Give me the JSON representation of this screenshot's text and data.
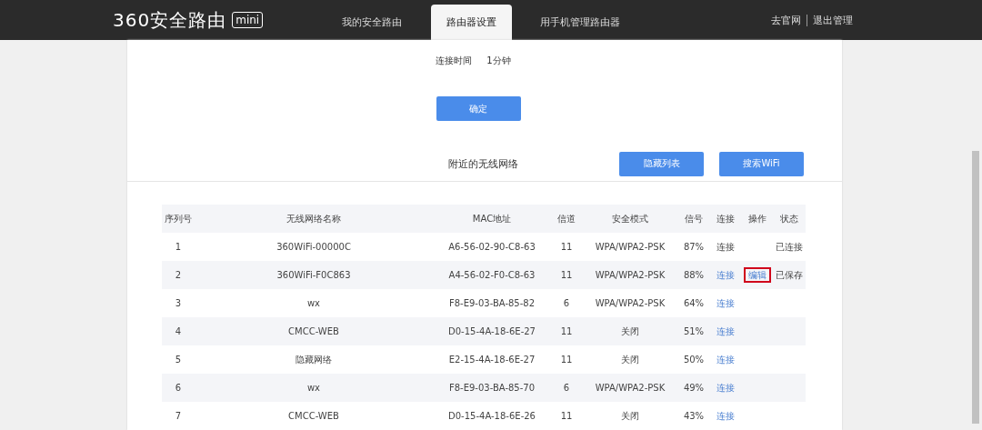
{
  "header": {
    "logo": {
      "name": "360安全路由",
      "edition": "mini"
    },
    "tabs": [
      {
        "label": "我的安全路由",
        "selected": false
      },
      {
        "label": "路由器设置",
        "selected": true
      },
      {
        "label": "用手机管理路由器",
        "selected": false
      }
    ],
    "links": [
      "去官网",
      "退出管理"
    ]
  },
  "settings": {
    "field_label": "连接时间",
    "field_value": "1分钟",
    "confirm_button": "确定"
  },
  "nearby": {
    "title": "附近的无线网络",
    "buttons": [
      "隐藏列表",
      "搜索WiFi"
    ]
  },
  "table": {
    "columns": [
      "序列号",
      "无线网络名称",
      "MAC地址",
      "信道",
      "安全模式",
      "信号",
      "连接",
      "操作",
      "状态"
    ],
    "rows": [
      {
        "index": "1",
        "ssid": "360WiFi-00000C",
        "mac": "A6-56-02-90-C8-63",
        "channel": "11",
        "security": "WPA/WPA2-PSK",
        "signal": "87%",
        "connect": {
          "label": "连接",
          "disabled": true
        },
        "status": "已连接"
      },
      {
        "index": "2",
        "ssid": "360WiFi-F0C863",
        "mac": "A4-56-02-F0-C8-63",
        "channel": "11",
        "security": "WPA/WPA2-PSK",
        "signal": "88%",
        "connect": {
          "label": "连接",
          "disabled": false
        },
        "action": {
          "label": "编辑",
          "highlighted": true
        },
        "status": "已保存"
      },
      {
        "index": "3",
        "ssid": "wx",
        "mac": "F8-E9-03-BA-85-82",
        "channel": "6",
        "security": "WPA/WPA2-PSK",
        "signal": "64%",
        "connect": {
          "label": "连接",
          "disabled": false
        }
      },
      {
        "index": "4",
        "ssid": "CMCC-WEB",
        "mac": "D0-15-4A-18-6E-27",
        "channel": "11",
        "security": "关闭",
        "signal": "51%",
        "connect": {
          "label": "连接",
          "disabled": false
        }
      },
      {
        "index": "5",
        "ssid": "隐藏网络",
        "mac": "E2-15-4A-18-6E-27",
        "channel": "11",
        "security": "关闭",
        "signal": "50%",
        "connect": {
          "label": "连接",
          "disabled": false
        }
      },
      {
        "index": "6",
        "ssid": "wx",
        "mac": "F8-E9-03-BA-85-70",
        "channel": "6",
        "security": "WPA/WPA2-PSK",
        "signal": "49%",
        "connect": {
          "label": "连接",
          "disabled": false
        }
      },
      {
        "index": "7",
        "ssid": "CMCC-WEB",
        "mac": "D0-15-4A-18-6E-26",
        "channel": "11",
        "security": "关闭",
        "signal": "43%",
        "connect": {
          "label": "连接",
          "disabled": false
        }
      }
    ]
  }
}
